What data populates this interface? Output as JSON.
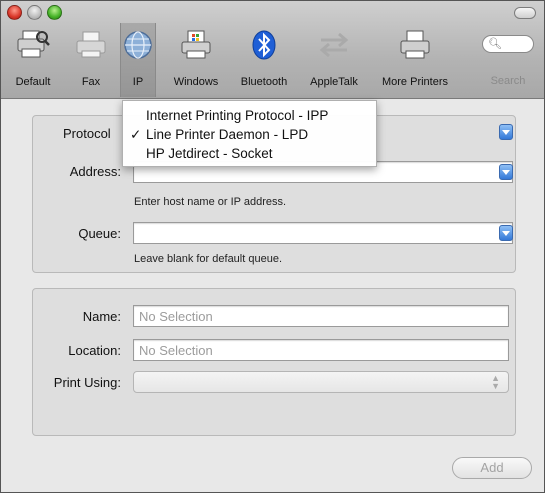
{
  "toolbar": {
    "items": [
      {
        "label": "Default",
        "icon": "printer-magnifier-icon"
      },
      {
        "label": "Fax",
        "icon": "fax-icon"
      },
      {
        "label": "IP",
        "icon": "globe-icon"
      },
      {
        "label": "Windows",
        "icon": "printer-windows-icon"
      },
      {
        "label": "Bluetooth",
        "icon": "bluetooth-icon"
      },
      {
        "label": "AppleTalk",
        "icon": "appletalk-arrows-icon"
      },
      {
        "label": "More Printers",
        "icon": "printer-icon"
      },
      {
        "label": "Search",
        "icon": "search-icon"
      }
    ],
    "selected": "IP"
  },
  "connection": {
    "protocol_label": "Protocol",
    "address_label": "Address:",
    "address_value": "",
    "address_hint": "Enter host name or IP address.",
    "queue_label": "Queue:",
    "queue_value": "",
    "queue_hint": "Leave blank for default queue."
  },
  "protocol_menu": {
    "options": [
      {
        "label": "Internet Printing Protocol - IPP",
        "checked": false
      },
      {
        "label": "Line Printer Daemon - LPD",
        "checked": true
      },
      {
        "label": "HP Jetdirect - Socket",
        "checked": false
      }
    ],
    "check_glyph": "✓"
  },
  "details": {
    "name_label": "Name:",
    "name_placeholder": "No Selection",
    "location_label": "Location:",
    "location_placeholder": "No Selection",
    "print_using_label": "Print Using:",
    "print_using_value": ""
  },
  "footer": {
    "add_label": "Add"
  },
  "colors": {
    "accent": "#3479d8",
    "close": "#d9372a",
    "zoom": "#45b227"
  }
}
